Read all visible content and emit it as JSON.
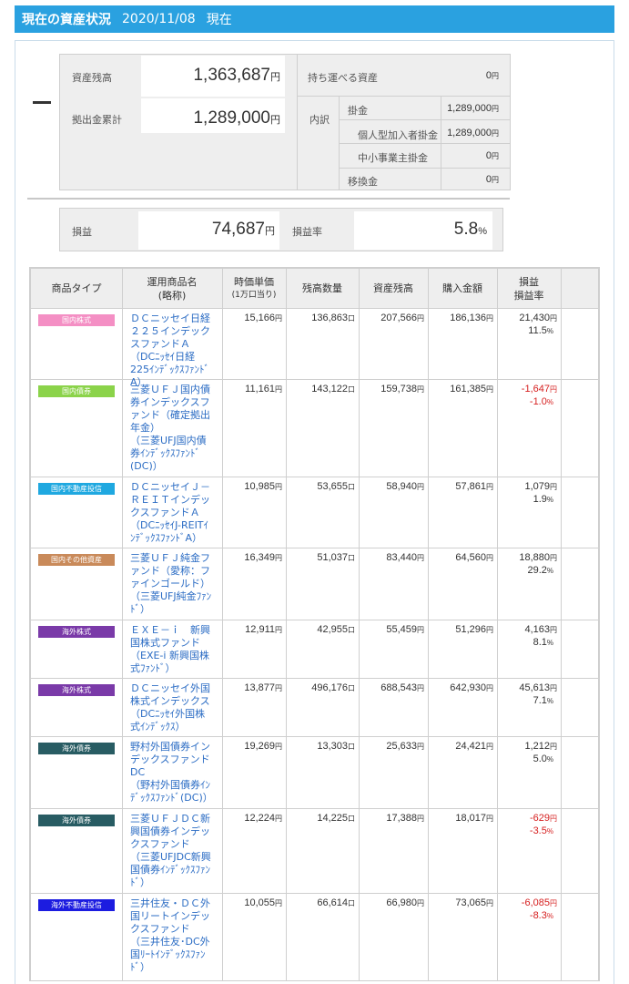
{
  "header": {
    "title": "現在の資産状況",
    "date": "2020/11/08",
    "now": "現在"
  },
  "summary": {
    "asset_balance_label": "資産残高",
    "asset_balance_value": "1,363,687",
    "contrib_total_label": "拠出金累計",
    "contrib_total_value": "1,289,000",
    "portable_label": "持ち運べる資産",
    "portable_value": "0",
    "breakdown_label": "内訳",
    "kakekin_label": "掛金",
    "kakekin_value": "1,289,000",
    "individual_label": "個人型加入者掛金",
    "individual_value": "1,289,000",
    "smb_label": "中小事業主掛金",
    "smb_value": "0",
    "transfer_label": "移換金",
    "transfer_value": "0",
    "yen": "円"
  },
  "profit": {
    "label": "損益",
    "value": "74,687",
    "rate_label": "損益率",
    "rate_value": "5.8",
    "percent": "%"
  },
  "table": {
    "headers": {
      "type": "商品タイプ",
      "name": "運用商品名",
      "name_sub": "(略称)",
      "price": "時価単価",
      "price_sub": "(1万口当り)",
      "qty": "残高数量",
      "balance": "資産残高",
      "purchase": "購入金額",
      "pl": "損益",
      "pl_rate": "損益率"
    },
    "units": {
      "yen": "円",
      "kuchi": "口",
      "pct": "%"
    },
    "rows": [
      {
        "type": "国内株式",
        "color": "#f48fc4",
        "name": "ＤＣニッセイ日経２２５インデックスファンドＡ\n（DCﾆｯｾｲ日経225ｲﾝﾃﾞｯｸｽﾌｧﾝﾄﾞA）",
        "price": "15,166",
        "qty": "136,863",
        "balance": "207,566",
        "purchase": "186,136",
        "pl": "21,430",
        "rate": "11.5",
        "negative": false
      },
      {
        "type": "国内債券",
        "color": "#8bd34a",
        "name": "三菱ＵＦＪ国内債券インデックスファンド（確定拠出年金）\n（三菱UFJ国内債券ｲﾝﾃﾞｯｸｽﾌｧﾝﾄﾞ(DC)）",
        "price": "11,161",
        "qty": "143,122",
        "balance": "159,738",
        "purchase": "161,385",
        "pl": "-1,647",
        "rate": "-1.0",
        "negative": true
      },
      {
        "type": "国内不動産投信",
        "color": "#1fa8e0",
        "name": "ＤＣニッセイＪ－ＲＥＩＴインデックスファンドＡ\n（DCﾆｯｾｲJ-REITｲﾝﾃﾞｯｸｽﾌｧﾝﾄﾞA）",
        "price": "10,985",
        "qty": "53,655",
        "balance": "58,940",
        "purchase": "57,861",
        "pl": "1,079",
        "rate": "1.9",
        "negative": false
      },
      {
        "type": "国内その他資産",
        "color": "#c98a5a",
        "name": "三菱ＵＦＪ純金ファンド（愛称：ファインゴールド）\n（三菱UFJ純金ﾌｧﾝﾄﾞ）",
        "price": "16,349",
        "qty": "51,037",
        "balance": "83,440",
        "purchase": "64,560",
        "pl": "18,880",
        "rate": "29.2",
        "negative": false
      },
      {
        "type": "海外株式",
        "color": "#7a3aa8",
        "name": "ＥＸＥ－ｉ　新興国株式ファンド\n（EXE-i 新興国株式ﾌｧﾝﾄﾞ）",
        "price": "12,911",
        "qty": "42,955",
        "balance": "55,459",
        "purchase": "51,296",
        "pl": "4,163",
        "rate": "8.1",
        "negative": false
      },
      {
        "type": "海外株式",
        "color": "#7a3aa8",
        "name": "ＤＣニッセイ外国株式インデックス\n（DCﾆｯｾｲ外国株式ｲﾝﾃﾞｯｸｽ）",
        "price": "13,877",
        "qty": "496,176",
        "balance": "688,543",
        "purchase": "642,930",
        "pl": "45,613",
        "rate": "7.1",
        "negative": false
      },
      {
        "type": "海外債券",
        "color": "#285c63",
        "name": "野村外国債券インデックスファンドDC\n（野村外国債券ｲﾝﾃﾞｯｸｽﾌｧﾝﾄﾞ(DC)）",
        "price": "19,269",
        "qty": "13,303",
        "balance": "25,633",
        "purchase": "24,421",
        "pl": "1,212",
        "rate": "5.0",
        "negative": false
      },
      {
        "type": "海外債券",
        "color": "#285c63",
        "name": "三菱ＵＦＪＤＣ新興国債券インデックスファンド\n（三菱UFJDC新興国債券ｲﾝﾃﾞｯｸｽﾌｧﾝﾄﾞ）",
        "price": "12,224",
        "qty": "14,225",
        "balance": "17,388",
        "purchase": "18,017",
        "pl": "-629",
        "rate": "-3.5",
        "negative": true
      },
      {
        "type": "海外不動産投信",
        "color": "#1c1ce0",
        "name": "三井住友・ＤＣ外国リートインデックスファンド\n（三井住友･DC外国ﾘｰﾄｲﾝﾃﾞｯｸｽﾌｧﾝﾄﾞ）",
        "price": "10,055",
        "qty": "66,614",
        "balance": "66,980",
        "purchase": "73,065",
        "pl": "-6,085",
        "rate": "-8.3",
        "negative": true
      }
    ]
  }
}
